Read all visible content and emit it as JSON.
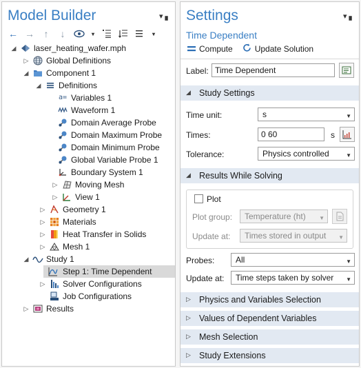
{
  "model_builder": {
    "title": "Model Builder",
    "pin": "▾ ▖",
    "toolbar": [
      "←",
      "→",
      "↑",
      "↓",
      "👁",
      "▾",
      "≡",
      "≡",
      "≡",
      "▾"
    ],
    "tree": [
      {
        "label": "laser_heating_wafer.mph",
        "icon": "model-icon",
        "expander": "◢"
      },
      {
        "label": "Global Definitions",
        "icon": "globe-icon",
        "expander": "▷"
      },
      {
        "label": "Component 1",
        "icon": "component-icon",
        "expander": "◢"
      },
      {
        "label": "Definitions",
        "icon": "definitions-icon",
        "expander": "◢"
      },
      {
        "label": "Variables 1",
        "icon": "variables-icon",
        "expander": ""
      },
      {
        "label": "Waveform 1",
        "icon": "waveform-icon",
        "expander": ""
      },
      {
        "label": "Domain Average Probe",
        "icon": "probe-icon",
        "expander": ""
      },
      {
        "label": "Domain Maximum Probe",
        "icon": "probe-icon",
        "expander": ""
      },
      {
        "label": "Domain Minimum Probe",
        "icon": "probe-icon",
        "expander": ""
      },
      {
        "label": "Global Variable Probe 1",
        "icon": "probe-icon",
        "expander": ""
      },
      {
        "label": "Boundary System 1",
        "icon": "coordinate-system-icon",
        "expander": ""
      },
      {
        "label": "Moving Mesh",
        "icon": "moving-mesh-icon",
        "expander": "▷"
      },
      {
        "label": "View 1",
        "icon": "view-icon",
        "expander": "▷"
      },
      {
        "label": "Geometry 1",
        "icon": "geometry-icon",
        "expander": "▷"
      },
      {
        "label": "Materials",
        "icon": "materials-icon",
        "expander": "▷"
      },
      {
        "label": "Heat Transfer in Solids",
        "icon": "heat-transfer-icon",
        "expander": "▷"
      },
      {
        "label": "Mesh 1",
        "icon": "mesh-icon",
        "expander": "▷"
      },
      {
        "label": "Study 1",
        "icon": "study-icon",
        "expander": "◢"
      },
      {
        "label": "Step 1: Time Dependent",
        "icon": "time-dependent-icon",
        "expander": ""
      },
      {
        "label": "Solver Configurations",
        "icon": "solver-icon",
        "expander": "▷"
      },
      {
        "label": "Job Configurations",
        "icon": "job-icon",
        "expander": ""
      },
      {
        "label": "Results",
        "icon": "results-icon",
        "expander": "▷"
      }
    ]
  },
  "settings": {
    "title": "Settings",
    "pin": "▾ ▖",
    "subtitle": "Time Dependent",
    "compute_label": "Compute",
    "update_solution_label": "Update Solution",
    "label_caption": "Label:",
    "label_value": "Time Dependent",
    "study_settings": {
      "header": "Study Settings",
      "time_unit_caption": "Time unit:",
      "time_unit_value": "s",
      "times_caption": "Times:",
      "times_value": "0 60",
      "times_unit": "s",
      "tolerance_caption": "Tolerance:",
      "tolerance_value": "Physics controlled"
    },
    "results_while_solving": {
      "header": "Results While Solving",
      "plot_label": "Plot",
      "plot_checked": false,
      "plot_group_caption": "Plot group:",
      "plot_group_value": "Temperature (ht)",
      "update_at_caption": "Update at:",
      "update_at_value": "Times stored in output",
      "probes_caption": "Probes:",
      "probes_value": "All",
      "probe_update_caption": "Update at:",
      "probe_update_value": "Time steps taken by solver"
    },
    "collapsed_sections": [
      "Physics and Variables Selection",
      "Values of Dependent Variables",
      "Mesh Selection",
      "Study Extensions"
    ]
  }
}
